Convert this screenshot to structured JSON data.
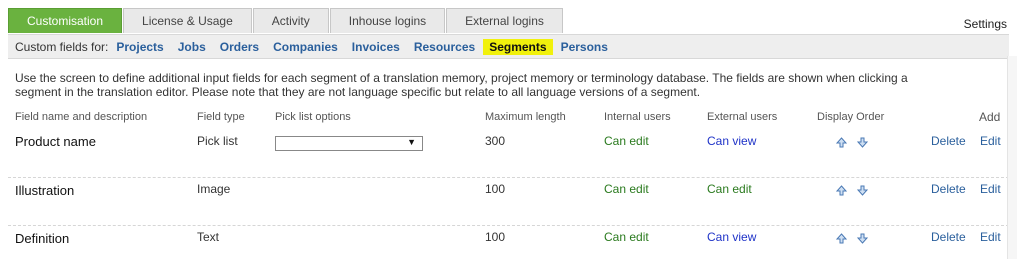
{
  "tabs": [
    "Customisation",
    "License & Usage",
    "Activity",
    "Inhouse logins",
    "External logins"
  ],
  "settings_label": "Settings",
  "custom_fields": {
    "label": "Custom fields for:",
    "links": [
      "Projects",
      "Jobs",
      "Orders",
      "Companies",
      "Invoices",
      "Resources",
      "Segments",
      "Persons"
    ]
  },
  "description": "Use the screen to define additional input fields for each segment of a translation memory, project memory or terminology database. The fields are shown when clicking a segment in the translation editor. Please note that they are not language specific but relate to all language versions of a segment.",
  "headers": {
    "name": "Field name and description",
    "type": "Field type",
    "picklist": "Pick list options",
    "maxlen": "Maximum length",
    "internal": "Internal users",
    "external": "External users",
    "order": "Display Order",
    "add": "Add"
  },
  "rows": [
    {
      "name": "Product name",
      "type": "Pick list",
      "maxlen": "300",
      "internal": "Can edit",
      "external": "Can view",
      "delete": "Delete",
      "edit": "Edit"
    },
    {
      "name": "Illustration",
      "type": "Image",
      "maxlen": "100",
      "internal": "Can edit",
      "external": "Can edit",
      "delete": "Delete",
      "edit": "Edit"
    },
    {
      "name": "Definition",
      "type": "Text",
      "maxlen": "100",
      "internal": "Can edit",
      "external": "Can view",
      "delete": "Delete",
      "edit": "Edit"
    }
  ],
  "colors": {
    "active_tab": "#6ab23f",
    "highlight": "#f1f10c",
    "link": "#2a5f9c",
    "can_edit": "#2a7a1e",
    "can_view": "#1f33c8"
  }
}
